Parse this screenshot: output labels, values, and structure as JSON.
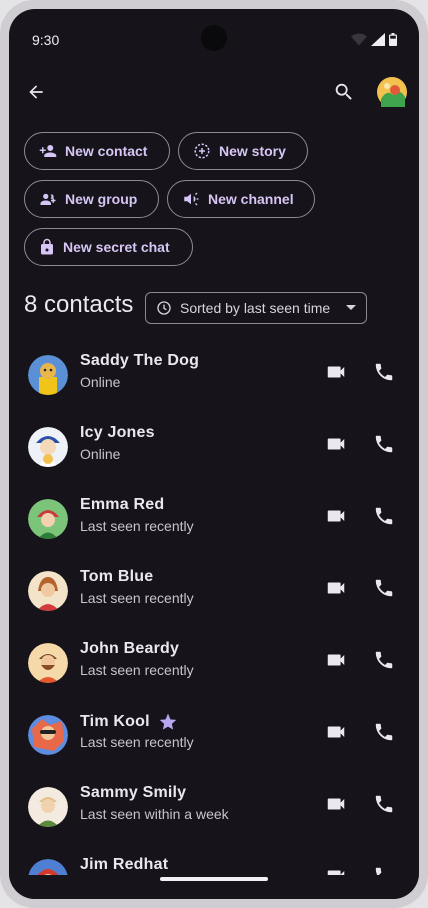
{
  "status_bar": {
    "time": "9:30"
  },
  "top_bar": {
    "back_icon": "arrow-back-icon",
    "search_icon": "search-icon",
    "profile_avatar": "avatar"
  },
  "actions": {
    "new_contact": "New contact",
    "new_story": "New story",
    "new_group": "New group",
    "new_channel": "New channel",
    "new_secret_chat": "New secret chat"
  },
  "contacts_header": {
    "count_label": "8 contacts",
    "sort_label": "Sorted by last seen time"
  },
  "contacts": [
    {
      "name": "Saddy The Dog",
      "status": "Online"
    },
    {
      "name": "Icy Jones",
      "status": "Online"
    },
    {
      "name": "Emma Red",
      "status": "Last seen recently"
    },
    {
      "name": "Tom Blue",
      "status": "Last seen recently"
    },
    {
      "name": "John Beardy",
      "status": "Last seen recently"
    },
    {
      "name": "Tim Kool",
      "status": "Last seen recently",
      "starred": true
    },
    {
      "name": "Sammy Smily",
      "status": "Last seen within a week"
    },
    {
      "name": "Jim Redhat",
      "status": ""
    }
  ],
  "colors": {
    "background": "#16131a",
    "accent": "#d6c6f5",
    "star": "#b9a6f0",
    "outline": "#8f8896"
  }
}
